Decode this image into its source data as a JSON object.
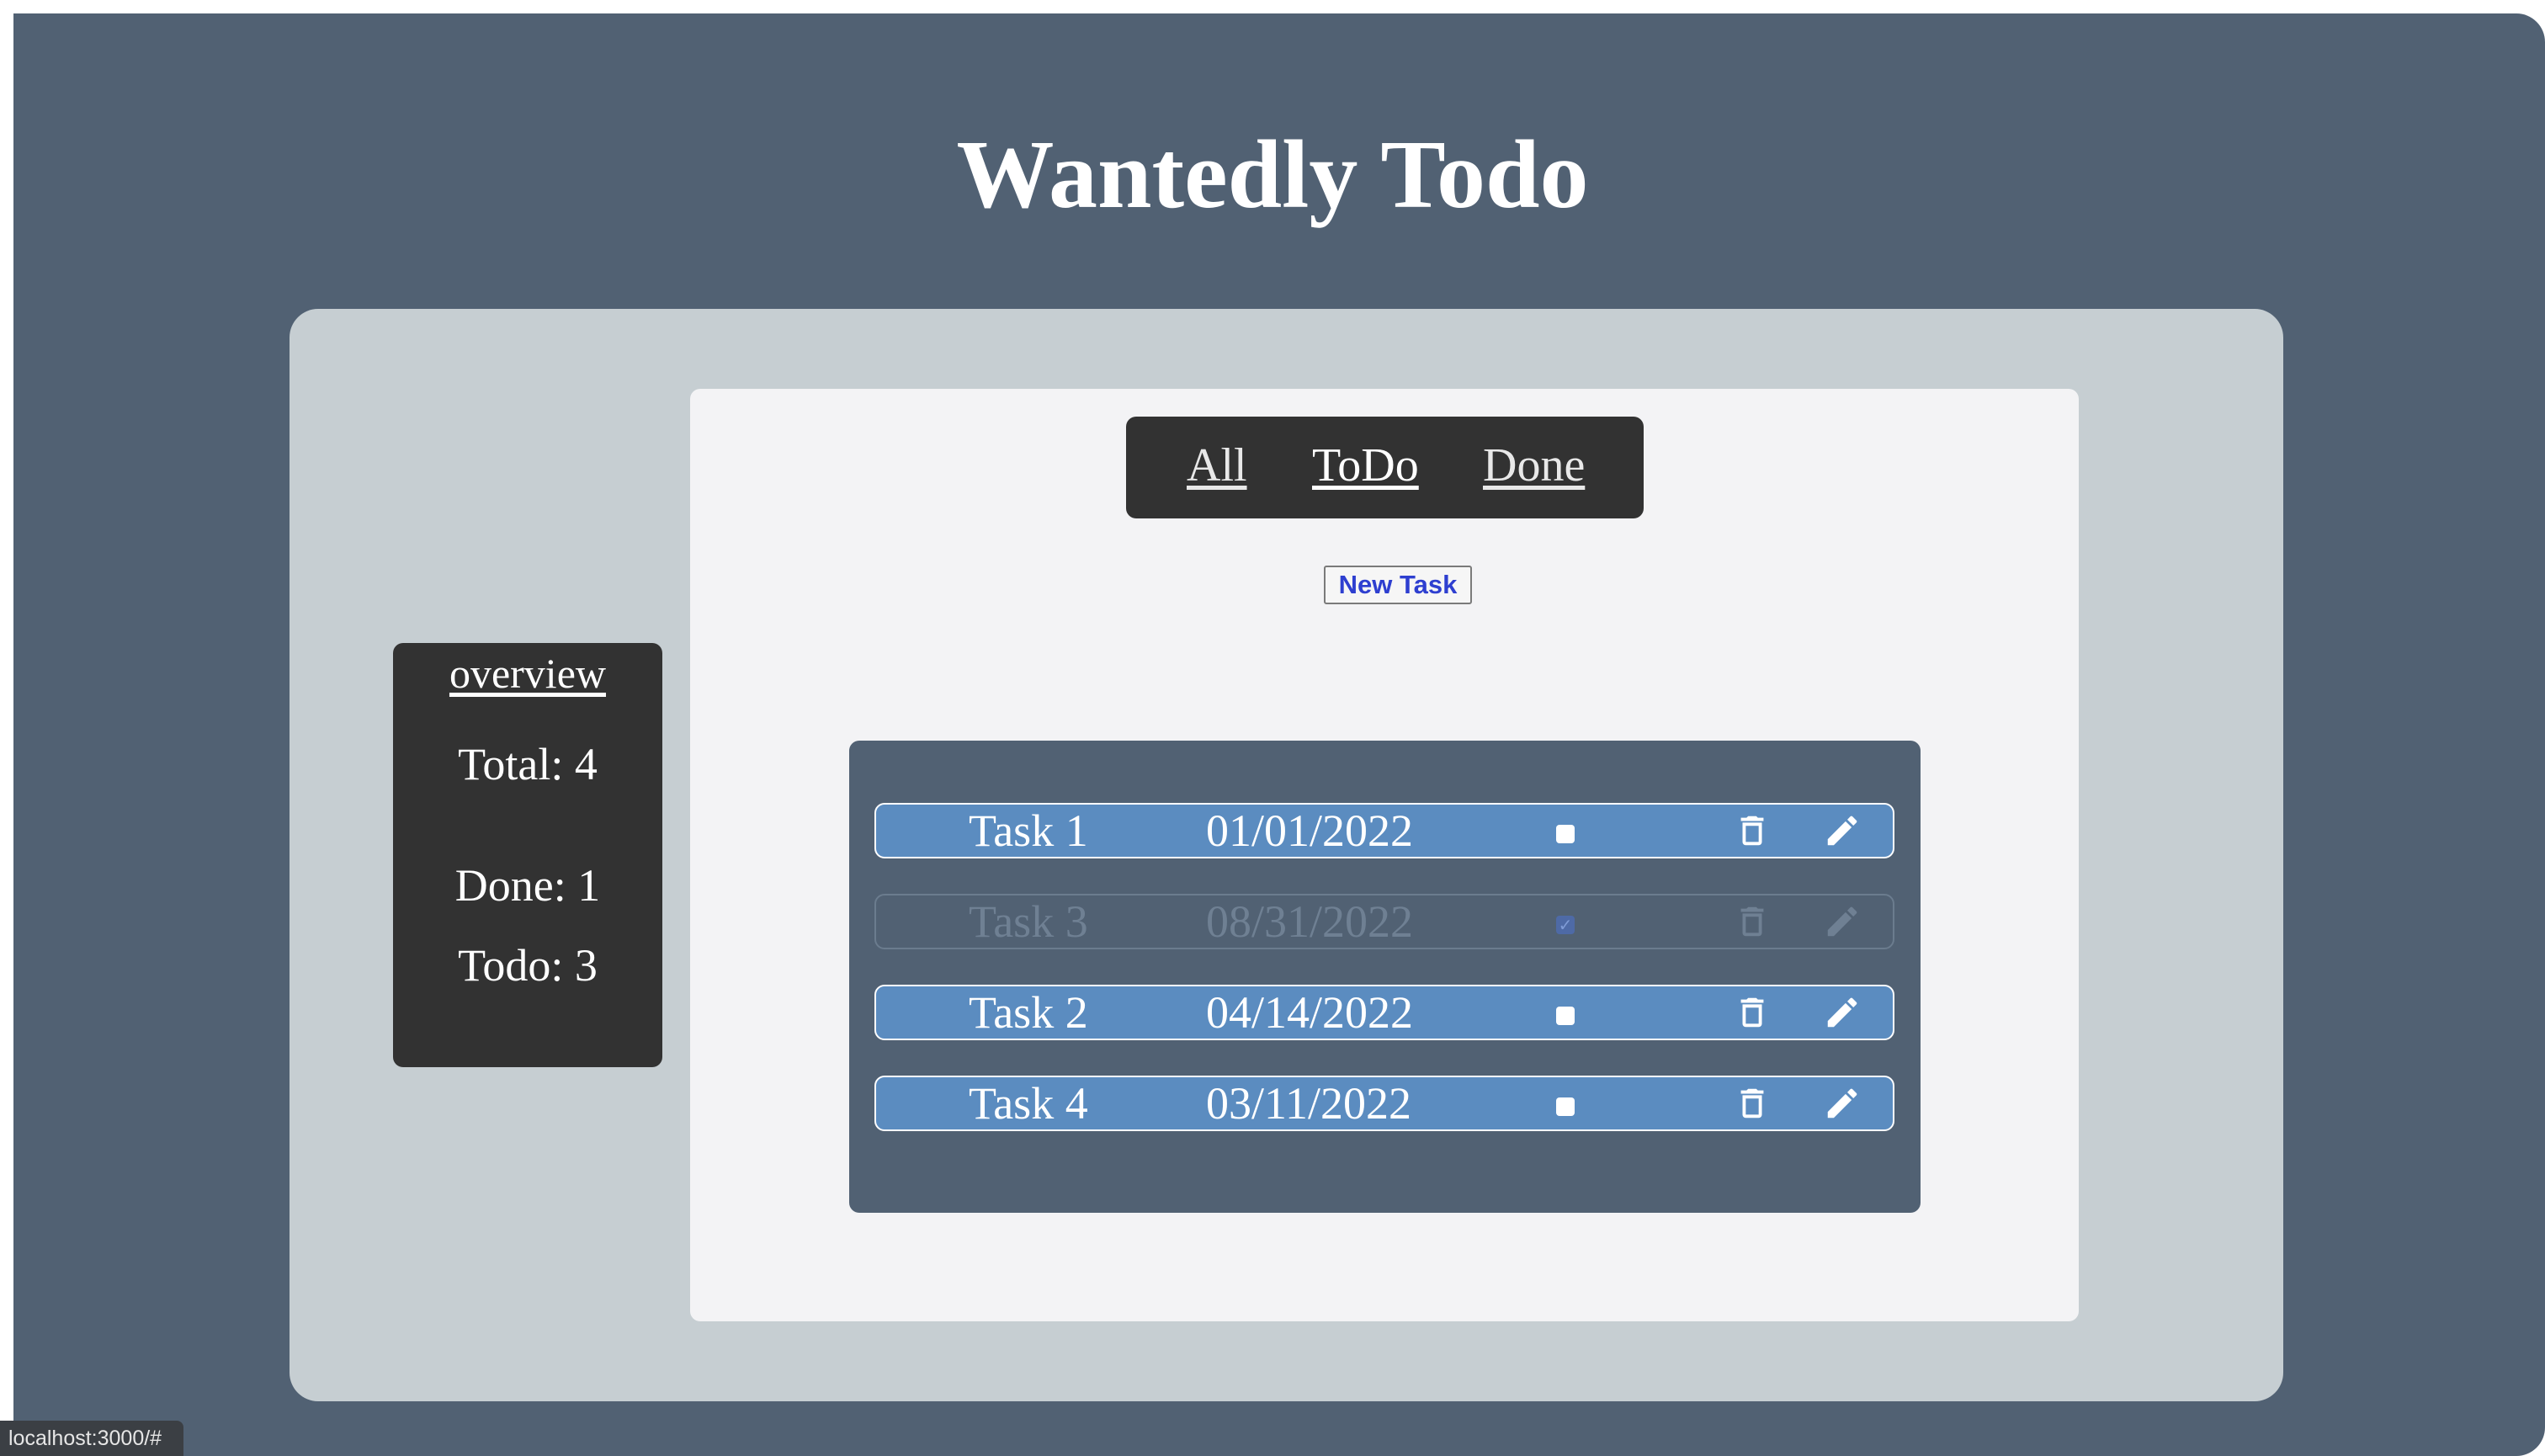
{
  "app": {
    "title": "Wantedly Todo"
  },
  "filters": {
    "all": "All",
    "todo": "ToDo",
    "done": "Done"
  },
  "toolbar": {
    "new_task_label": "New Task"
  },
  "overview": {
    "title": "overview",
    "total": "Total: 4",
    "done": "Done: 1",
    "todo": "Todo: 3"
  },
  "tasks": [
    {
      "name": "Task 1",
      "date": "01/01/2022",
      "done": false
    },
    {
      "name": "Task 3",
      "date": "08/31/2022",
      "done": true
    },
    {
      "name": "Task 2",
      "date": "04/14/2022",
      "done": false
    },
    {
      "name": "Task 4",
      "date": "03/11/2022",
      "done": false
    }
  ],
  "icons": {
    "delete": "trash-icon",
    "edit": "pencil-icon"
  },
  "status": {
    "url": "localhost:3000/#"
  },
  "colors": {
    "background": "#516173",
    "panel": "#c6ced2",
    "card": "#f3f3f5",
    "dark": "#323232",
    "task": "#5b8cc0",
    "link": "#2e3fd0"
  }
}
